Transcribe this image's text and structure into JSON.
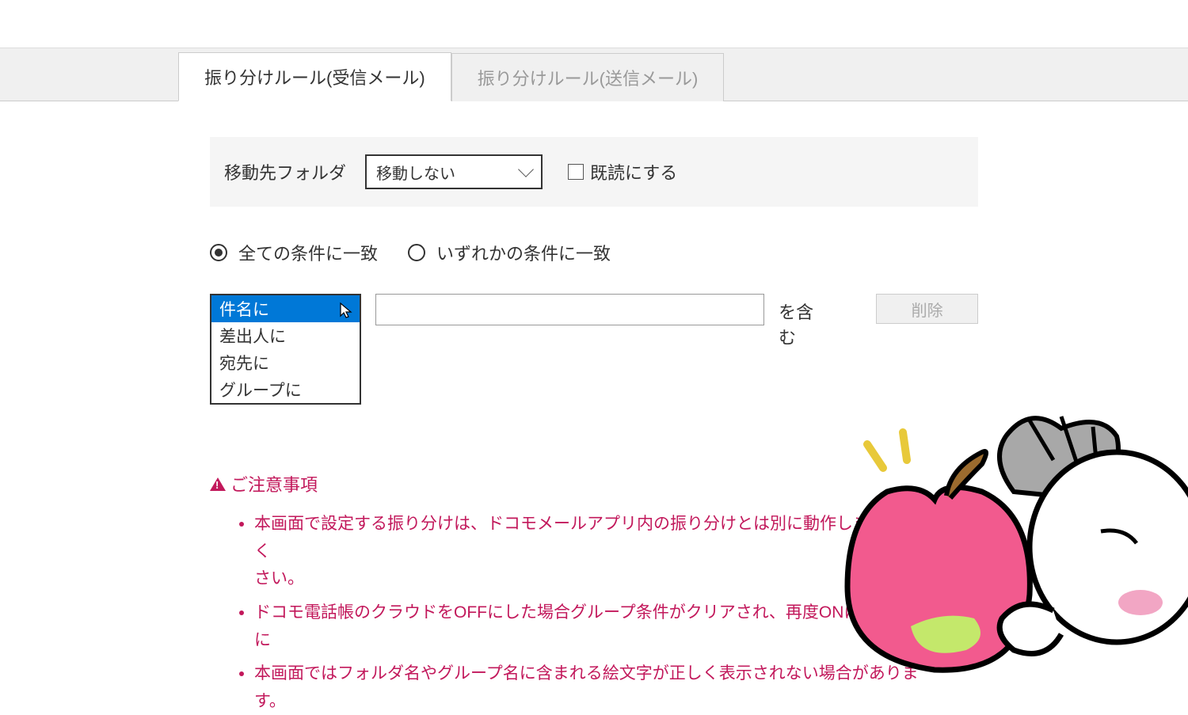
{
  "tabs": {
    "receive": "振り分けルール(受信メール)",
    "send": "振り分けルール(送信メール)"
  },
  "folder": {
    "label": "移動先フォルダ",
    "selected": "移動しない",
    "read_label": "既読にする"
  },
  "match": {
    "all": "全ての条件に一致",
    "any": "いずれかの条件に一致"
  },
  "condition": {
    "options": {
      "subject": "件名に",
      "sender": "差出人に",
      "recipient": "宛先に",
      "group": "グループに"
    },
    "input_value": "",
    "suffix": "を含む",
    "delete": "削除"
  },
  "warning": {
    "title": "ご注意事項",
    "items": {
      "i0a": "本画面で設定する振り分けは、ドコモメールアプリ内の振り分けとは別に動作します。詳しく",
      "i0b": "さい。",
      "i1": "ドコモ電話帳のクラウドをOFFにした場合グループ条件がクリアされ、再度ONにした場合に",
      "i2": "本画面ではフォルダ名やグループ名に含まれる絵文字が正しく表示されない場合があります。"
    }
  }
}
